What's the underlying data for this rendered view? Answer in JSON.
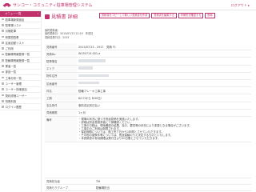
{
  "header": {
    "app_title": "サンコー・コミュニティ駐車場管理システム",
    "logout": "ログアウト ▸"
  },
  "sidebar": {
    "head_label": "メニュー一覧",
    "items": [
      {
        "label": "駐車場新規追加"
      },
      {
        "label": "駐車場リスト"
      },
      {
        "label": "月極駐車"
      },
      {
        "label": "時間貸駐車"
      },
      {
        "label": "区画自動リスト"
      },
      {
        "label": "ご利用"
      },
      {
        "label": "駐輪場情報登録一覧"
      },
      {
        "label": "駐輪場情報登録一覧"
      },
      {
        "label": "業者一覧"
      },
      {
        "label": "部品一覧"
      },
      {
        "label": "工事分析一覧"
      },
      {
        "label": "ユーザー管理"
      },
      {
        "label": "ユーザー詳細追加"
      },
      {
        "label": "契約詳細ユーザー"
      },
      {
        "label": "特殊利用"
      },
      {
        "label": "ログイン履歴"
      }
    ]
  },
  "page": {
    "title": "見積書 詳細",
    "buttons": {
      "copy": "見積書をコピーして新しい見積書を作成",
      "edit": "見積書を編集する",
      "print": "印刷形式確認する",
      "delete": "削除"
    },
    "meta": [
      "最終更新者：",
      "最終更新日：2015/07/13 22:19　作成日",
      "見積書発行日：2015"
    ]
  },
  "details": [
    {
      "key": "見積番号",
      "value": "2015/07/13 - 2917　見積 F1"
    },
    {
      "key": "見積No",
      "value": "W150713-001-a"
    },
    {
      "key": "駐車場名",
      "value": ""
    },
    {
      "key": "エリア",
      "value": ""
    },
    {
      "key": "物件住所",
      "value": ""
    },
    {
      "key": "区画番号",
      "value": ""
    },
    {
      "key": "件名",
      "value": "駐輪ブレーキ工事工事"
    },
    {
      "key": "工期",
      "value": "8/27/から 8/30日/"
    },
    {
      "key": "支払条件",
      "value": "事前支払別日払い"
    },
    {
      "key": "見積期限",
      "value": "1ヶ月"
    }
  ],
  "notes": {
    "key": "備考",
    "lines": [
      "・現場の状況に基づき別途見積を実施いたします。",
      "・詳細は別途見積書面にて御確認ください。",
      "・工事の日程は、現地確認の結果、及び、要員等の状況により変更となる場合がございます。",
      "・工事中のご利用は制限されます。",
      "・保証期間については、施工完了日から1年間とさせていただきます。",
      "・その他の諸条件等については、別途協議のうえ決定するものといたします。",
      "・本見積書の有効期限は発行日より30日間とさせていただきます。"
    ]
  },
  "bottom": [
    {
      "key": "見積担当者",
      "value": "TM"
    },
    {
      "key": "見積もりグループ",
      "value": "駐輪場担当"
    }
  ]
}
